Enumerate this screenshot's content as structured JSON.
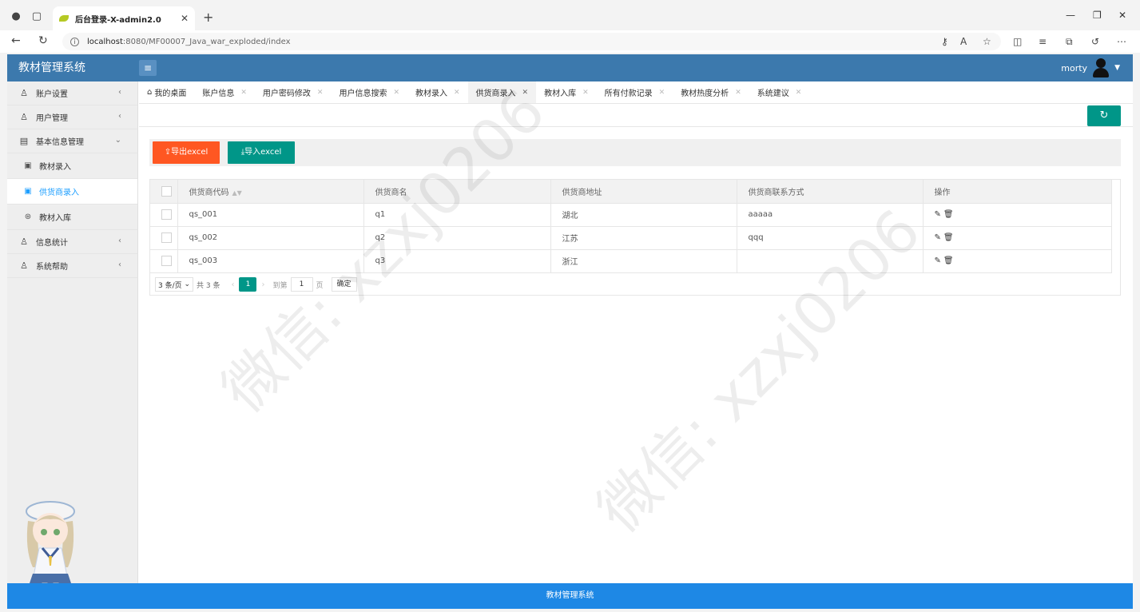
{
  "browser": {
    "tab_title": "后台登录-X-admin2.0",
    "url_host": "localhost",
    "url_path": ":8080/MF00007_Java_war_exploded/index"
  },
  "app": {
    "logo": "教材管理系统",
    "username": "morty",
    "footer": "教材管理系统"
  },
  "sidebar": {
    "items": [
      {
        "label": "账户设置",
        "icon": "user-icon"
      },
      {
        "label": "用户管理",
        "icon": "user-icon"
      },
      {
        "label": "基本信息管理",
        "icon": "form-icon"
      },
      {
        "label": "教材录入",
        "icon": "doc-icon"
      },
      {
        "label": "供货商录入",
        "icon": "doc-icon"
      },
      {
        "label": "教材入库",
        "icon": "box-icon"
      },
      {
        "label": "信息统计",
        "icon": "user-icon"
      },
      {
        "label": "系统帮助",
        "icon": "user-icon"
      }
    ]
  },
  "page_tabs": [
    {
      "label": "我的桌面"
    },
    {
      "label": "账户信息"
    },
    {
      "label": "用户密码修改"
    },
    {
      "label": "用户信息搜索"
    },
    {
      "label": "教材录入"
    },
    {
      "label": "供货商录入"
    },
    {
      "label": "教材入库"
    },
    {
      "label": "所有付款记录"
    },
    {
      "label": "教材热度分析"
    },
    {
      "label": "系统建议"
    }
  ],
  "toolbar": {
    "export_label": "导出excel",
    "import_label": "导入excel"
  },
  "table": {
    "headers": [
      "供货商代码",
      "供货商名",
      "供货商地址",
      "供货商联系方式",
      "操作"
    ],
    "rows": [
      {
        "code": "qs_001",
        "name": "q1",
        "address": "湖北",
        "contact": "aaaaa"
      },
      {
        "code": "qs_002",
        "name": "q2",
        "address": "江苏",
        "contact": "qqq"
      },
      {
        "code": "qs_003",
        "name": "q3",
        "address": "浙江",
        "contact": ""
      }
    ]
  },
  "pager": {
    "page_size": "3 条/页",
    "total": "共 3 条",
    "current_page": "1",
    "goto_label": "到第",
    "goto_value": "1",
    "page_unit": "页",
    "confirm": "确定"
  },
  "watermark": "微信: xzxj0206",
  "colors": {
    "header_blue": "#3c79ad",
    "footer_blue": "#1e88e5",
    "teal": "#009688",
    "orange": "#ff5722",
    "active_link": "#1e9fff"
  }
}
